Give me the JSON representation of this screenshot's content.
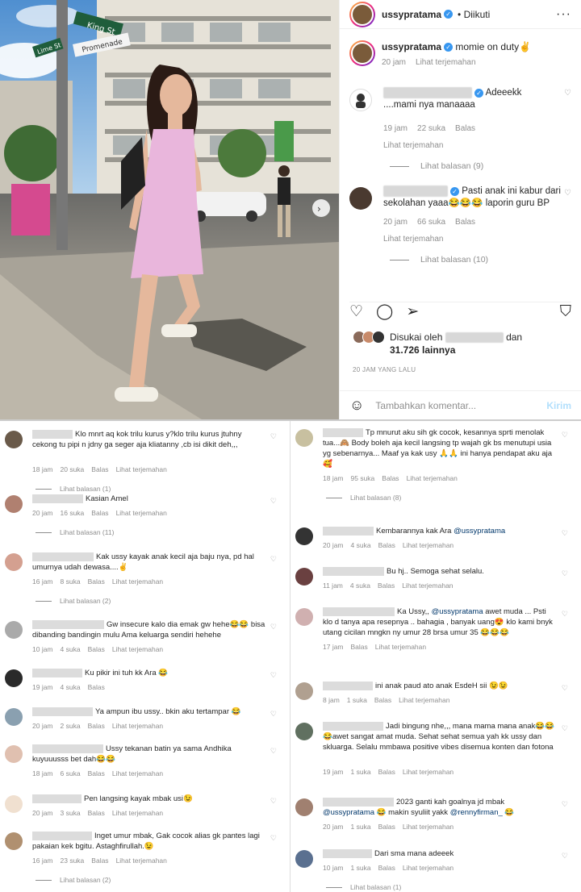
{
  "post": {
    "username": "ussypratama",
    "follow_status": "Diikuti",
    "caption": "momie on duty✌",
    "caption_time": "20 jam",
    "see_translation": "Lihat terjemahan",
    "photo_signs": {
      "king": "King St",
      "promenade": "Promenade",
      "lime": "Lime St"
    },
    "comments": [
      {
        "text_line1": "Adeeekk",
        "text_line2": "....mami nya manaaaa",
        "time": "19 jam",
        "likes": "22 suka",
        "reply": "Balas",
        "translation": "Lihat terjemahan",
        "view_replies": "Lihat balasan (9)"
      },
      {
        "text": "Pasti anak ini kabur dari sekolahan yaaa😂😂😂 laporin guru BP",
        "time": "20 jam",
        "likes": "66 suka",
        "reply": "Balas",
        "translation": "Lihat terjemahan",
        "view_replies": "Lihat balasan (10)"
      }
    ],
    "liked_by": "Disukai oleh",
    "liked_and": "dan",
    "liked_others": "31.726 lainnya",
    "timestamp": "20 JAM YANG LALU",
    "add_comment_placeholder": "Tambahkan komentar...",
    "send_label": "Kirim"
  },
  "left_comments": [
    {
      "text": "Klo mnrt aq kok trilu kurus y?klo trilu kurus jtuhny cekong tu pipi n jdny ga seger aja kliatanny ,cb isi dikit deh,,,",
      "meta": [
        "18 jam",
        "20 suka",
        "Balas",
        "Lihat terjemahan"
      ],
      "replies": "Lihat balasan (1)"
    },
    {
      "text": "Kasian Amel",
      "meta": [
        "20 jam",
        "16 suka",
        "Balas",
        "Lihat terjemahan"
      ],
      "replies": "Lihat balasan (11)"
    },
    {
      "text": "Kak ussy kayak anak kecil aja baju nya, pd hal umurnya udah dewasa....✌",
      "meta": [
        "16 jam",
        "8 suka",
        "Balas",
        "Lihat terjemahan"
      ],
      "replies": "Lihat balasan (2)"
    },
    {
      "text": "Gw insecure kalo dia emak gw hehe😂😂 bisa dibanding bandingin mulu Ama keluarga sendiri hehehe",
      "meta": [
        "10 jam",
        "4 suka",
        "Balas",
        "Lihat terjemahan"
      ],
      "replies": ""
    },
    {
      "text": "Ku pikir ini tuh kk Ara 😂",
      "meta": [
        "19 jam",
        "4 suka",
        "Balas"
      ],
      "replies": ""
    },
    {
      "text": "Ya ampun ibu ussy.. bkin aku tertampar 😂",
      "meta": [
        "20 jam",
        "2 suka",
        "Balas",
        "Lihat terjemahan"
      ],
      "replies": ""
    },
    {
      "text": "Ussy tekanan batin ya sama Andhika kuyuuusss bet dah😂😂",
      "meta": [
        "18 jam",
        "6 suka",
        "Balas",
        "Lihat terjemahan"
      ],
      "replies": ""
    },
    {
      "text": "Pen langsing kayak mbak usi😉",
      "meta": [
        "20 jam",
        "3 suka",
        "Balas",
        "Lihat terjemahan"
      ],
      "replies": ""
    },
    {
      "text": "Inget umur mbak, Gak cocok alias gk pantes lagi pakaian kek bgitu. Astaghfirullah.😉",
      "meta": [
        "16 jam",
        "23 suka",
        "Balas",
        "Lihat terjemahan"
      ],
      "replies": "Lihat balasan (2)"
    }
  ],
  "right_comments": [
    {
      "text": "Tp mnurut aku sih gk cocok, kesannya sprti menolak tua...🙈 Body boleh aja kecil langsing tp wajah gk bs menutupi usia yg sebenarnya... Maaf ya kak usy 🙏🙏 ini hanya pendapat aku aja 🥰",
      "meta": [
        "18 jam",
        "95 suka",
        "Balas",
        "Lihat terjemahan"
      ],
      "replies": "Lihat balasan (8)"
    },
    {
      "text": "Kembarannya kak Ara",
      "mention": "@ussypratama",
      "meta": [
        "20 jam",
        "4 suka",
        "Balas",
        "Lihat terjemahan"
      ],
      "replies": ""
    },
    {
      "text": "Bu hj.. Semoga sehat selalu.",
      "meta": [
        "11 jam",
        "4 suka",
        "Balas",
        "Lihat terjemahan"
      ],
      "replies": ""
    },
    {
      "text_pre": "Ka Ussy,,",
      "mention": "@ussypratama",
      "text": "awet muda ... Psti klo d tanya apa resepnya .. bahagia , banyak uang😍 klo kami bnyk utang cicilan mngkn ny umur 28 brsa umur 35 😂😂😂",
      "meta": [
        "17 jam",
        "Balas",
        "Lihat terjemahan"
      ],
      "replies": ""
    },
    {
      "text": "ini anak paud ato anak EsdeH sii 😉😉",
      "meta": [
        "8 jam",
        "1 suka",
        "Balas",
        "Lihat terjemahan"
      ],
      "replies": ""
    },
    {
      "text": "Jadi bingung nhe,,, mana mama mana anak😂😂 😂awet sangat amat muda. Sehat sehat semua yah kk ussy dan skluarga. Selalu mmbawa positive vibes disemua konten dan fotona",
      "meta": [
        "19 jam",
        "1 suka",
        "Balas",
        "Lihat terjemahan"
      ],
      "replies": ""
    },
    {
      "text_pre": "2023 ganti kah goalnya jd mbak",
      "mention": "@ussypratama",
      "text": "😂 makin syuliit yakk",
      "mention2": "@rennyfirman_",
      "text_post": "😂",
      "meta": [
        "20 jam",
        "1 suka",
        "Balas",
        "Lihat terjemahan"
      ],
      "replies": ""
    },
    {
      "text": "Dari sma mana adeeek",
      "meta": [
        "10 jam",
        "1 suka",
        "Balas",
        "Lihat terjemahan"
      ],
      "replies": "Lihat balasan (1)"
    }
  ],
  "colors": {
    "verified": "#3897f0",
    "dress": "#e9b6dc",
    "sky": "#6ea6d6",
    "mention": "#00376b"
  }
}
